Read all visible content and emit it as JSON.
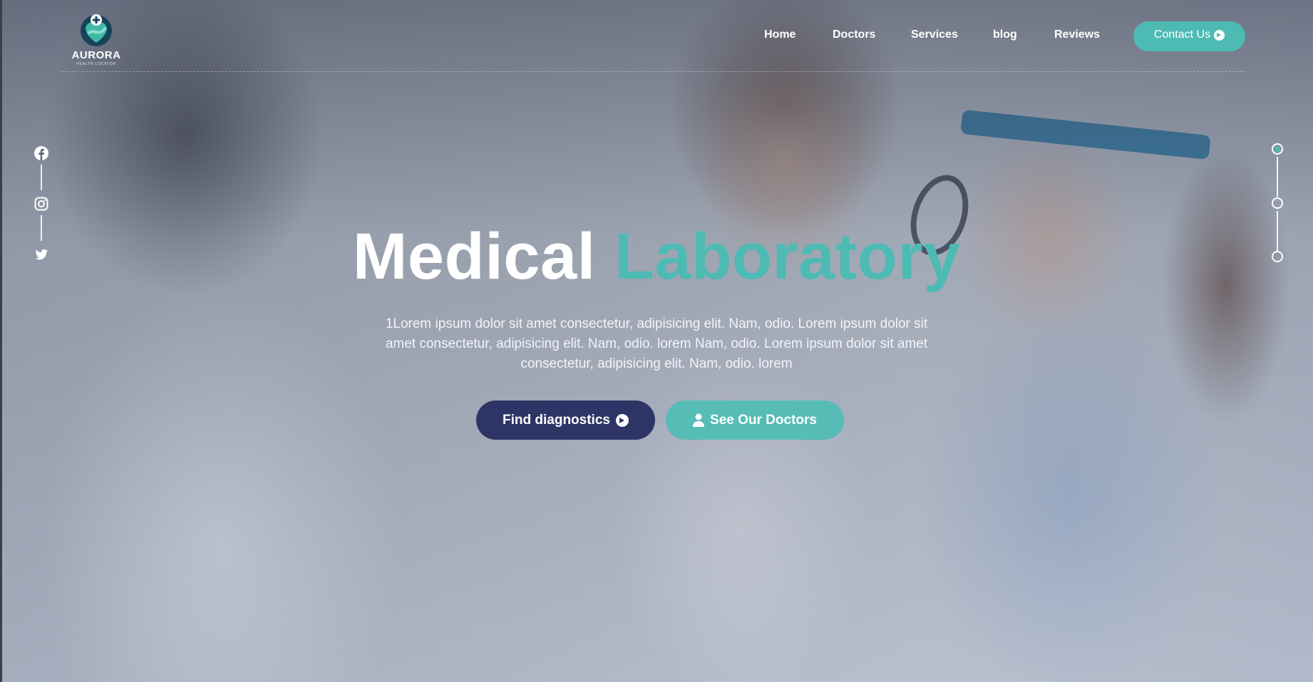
{
  "brand": {
    "name": "AURORA",
    "tagline": "HEALTH LOCATOR",
    "logo_icon": "heart-cross-logo-icon"
  },
  "nav": {
    "items": [
      {
        "label": "Home"
      },
      {
        "label": "Doctors"
      },
      {
        "label": "Services"
      },
      {
        "label": "blog"
      },
      {
        "label": "Reviews"
      }
    ],
    "contact_label": "Contact Us",
    "contact_icon": "arrow-circle-right-icon"
  },
  "social": {
    "icons": [
      "facebook-icon",
      "instagram-icon",
      "twitter-icon"
    ]
  },
  "slider": {
    "count": 3,
    "active_index": 0
  },
  "hero": {
    "title_main": "Medical",
    "title_accent": "Laboratory",
    "description": "1Lorem ipsum dolor sit amet consectetur, adipisicing elit. Nam, odio. Lorem ipsum dolor sit amet consectetur, adipisicing elit. Nam, odio. lorem Nam, odio. Lorem ipsum dolor sit amet consectetur, adipisicing elit. Nam, odio. lorem",
    "primary_button": "Find diagnostics",
    "secondary_button": "See Our Doctors"
  },
  "colors": {
    "accent": "#4dbbb3",
    "primary_button": "#2e3566",
    "text_on_dark": "#ffffff"
  }
}
